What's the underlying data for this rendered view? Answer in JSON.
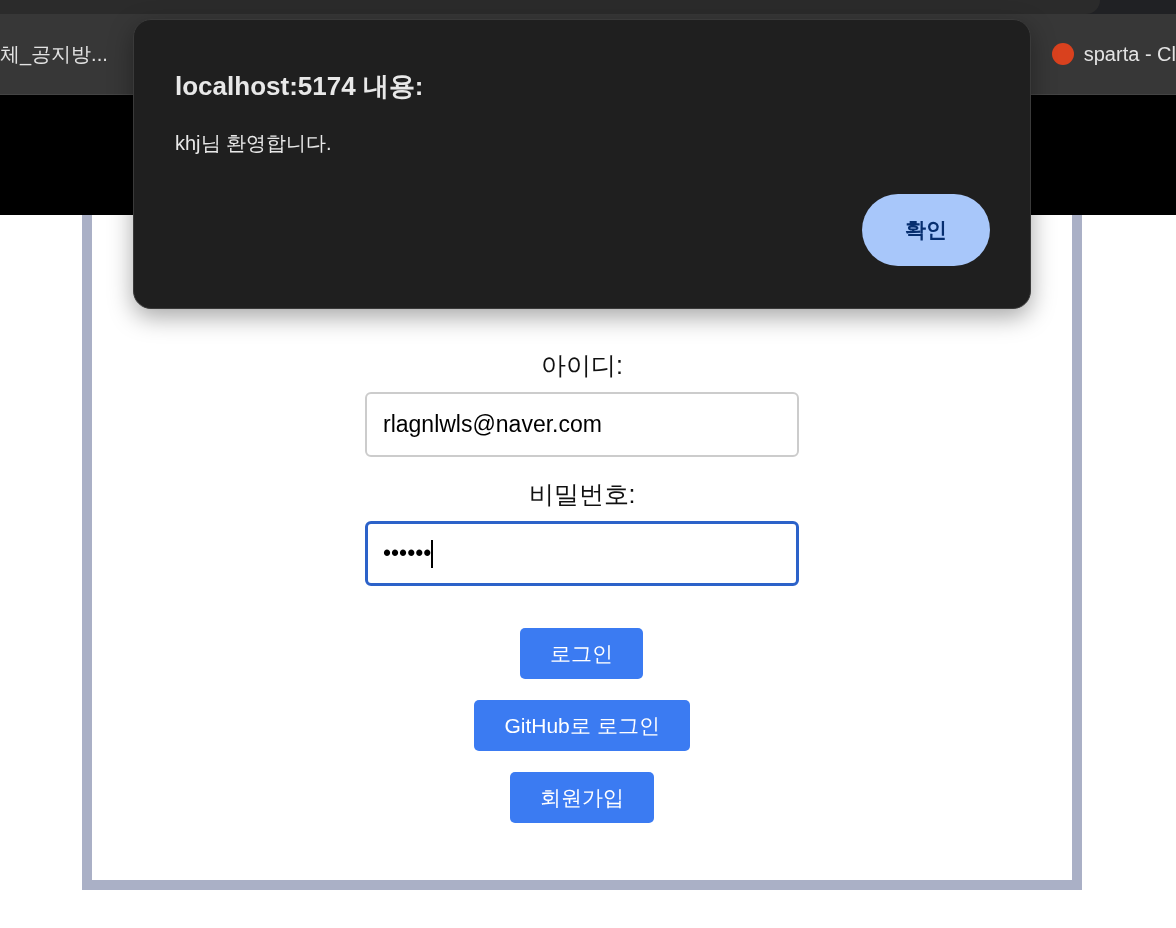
{
  "bookmarks_bar": {
    "items": [
      {
        "label": "체_공지방..."
      },
      {
        "label": "sparta - Cl"
      }
    ]
  },
  "login_form": {
    "fields": [
      {
        "label": "아이디:",
        "value": "rlagnlwls@naver.com",
        "focused": false
      },
      {
        "label": "비밀번호:",
        "value": "••••••",
        "focused": true
      }
    ],
    "buttons": [
      "로그인",
      "GitHub로 로그인",
      "회원가입"
    ]
  },
  "alert_dialog": {
    "title": "localhost:5174 내용:",
    "message": "khj님 환영합니다.",
    "button": "확인"
  }
}
